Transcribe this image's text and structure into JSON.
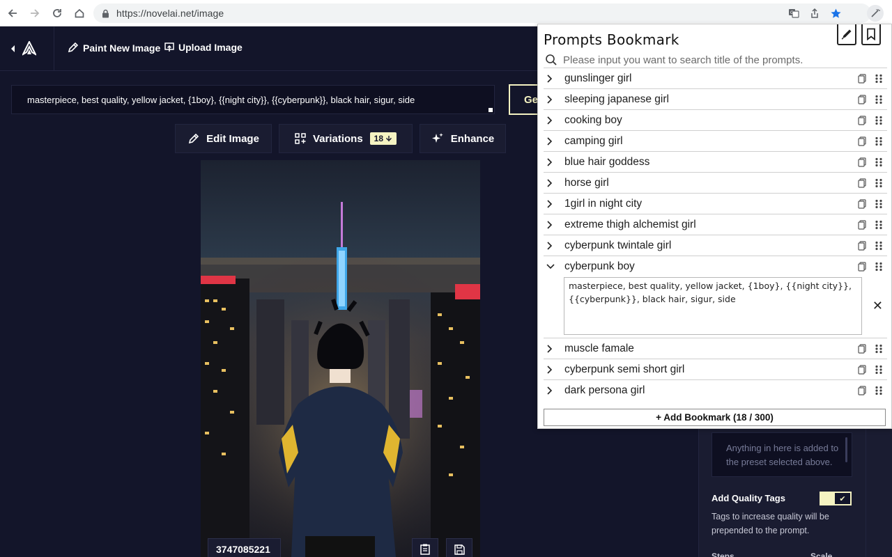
{
  "browser": {
    "url": "https://novelai.net/image"
  },
  "app": {
    "actions": {
      "paint_new": "Paint New Image",
      "upload": "Upload Image"
    },
    "prompt": "masterpiece, best quality, yellow jacket, {1boy}, {{night city}}, {{cyberpunk}}, black hair, sigur, side",
    "generate_label": "Gen",
    "tools": {
      "edit": "Edit Image",
      "variations": "Variations",
      "variations_cost": "18",
      "enhance": "Enhance"
    },
    "seed": "3747085221",
    "settings": {
      "uc_text": "Anything in here is added to the preset selected above.",
      "quality_tags_label": "Add Quality Tags",
      "quality_tags_on": true,
      "quality_tags_desc": "Tags to increase quality will be prepended to the prompt.",
      "steps_cut": "Steps",
      "scale_cut": "Scale"
    },
    "colors": {
      "bg": "#13152a",
      "accent": "#f5f3c2"
    }
  },
  "bookmark": {
    "title": "Prompts Bookmark",
    "search_placeholder": "Please input you want to search title of the prompts.",
    "items": [
      {
        "name": "gunslinger girl"
      },
      {
        "name": "sleeping japanese girl"
      },
      {
        "name": "cooking boy"
      },
      {
        "name": "camping girl"
      },
      {
        "name": "blue hair goddess"
      },
      {
        "name": "horse girl"
      },
      {
        "name": "1girl in night city"
      },
      {
        "name": "extreme thigh alchemist girl"
      },
      {
        "name": "cyberpunk twintale girl"
      },
      {
        "name": "cyberpunk boy",
        "expanded": true,
        "prompt": "masterpiece, best quality, yellow jacket, {1boy}, {{night city}}, {{cyberpunk}}, black hair, sigur, side"
      },
      {
        "name": "muscle famale"
      },
      {
        "name": "cyberpunk semi short girl"
      },
      {
        "name": "dark persona girl"
      }
    ],
    "add_button": "+ Add Bookmark (18 / 300)"
  }
}
